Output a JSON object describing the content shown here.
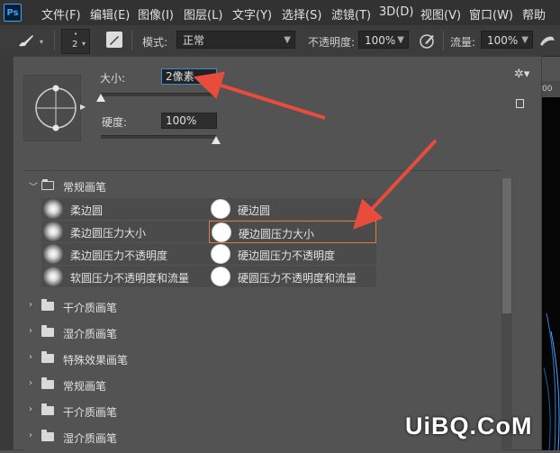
{
  "app": {
    "logo": "Ps"
  },
  "menu": [
    {
      "label": "文件(F)"
    },
    {
      "label": "编辑(E)"
    },
    {
      "label": "图像(I)"
    },
    {
      "label": "图层(L)"
    },
    {
      "label": "文字(Y)"
    },
    {
      "label": "选择(S)"
    },
    {
      "label": "滤镜(T)"
    },
    {
      "label": "3D(D)"
    },
    {
      "label": "视图(V)"
    },
    {
      "label": "窗口(W)"
    },
    {
      "label": "帮助"
    }
  ],
  "options": {
    "brush_size": "2",
    "mode_label": "模式:",
    "mode_value": "正常",
    "opacity_label": "不透明度:",
    "opacity_value": "100%",
    "flow_label": "流量:",
    "flow_value": "100%"
  },
  "brush_panel": {
    "size_label": "大小:",
    "size_value": "2",
    "size_unit": "像素",
    "hardness_label": "硬度:",
    "hardness_value": "100%",
    "size_slider_fraction": 0.0,
    "hardness_slider_fraction": 1.0
  },
  "ruler_value": "00",
  "groups": [
    {
      "label": "常规画笔",
      "expanded": true,
      "brushes": [
        {
          "name": "柔边圆",
          "type": "soft"
        },
        {
          "name": "硬边圆",
          "type": "hard"
        },
        {
          "name": "柔边圆压力大小",
          "type": "soft"
        },
        {
          "name": "硬边圆压力大小",
          "type": "hard",
          "selected": true
        },
        {
          "name": "柔边圆压力不透明度",
          "type": "soft"
        },
        {
          "name": "硬边圆压力不透明度",
          "type": "hard"
        },
        {
          "name": "软圆压力不透明度和流量",
          "type": "soft"
        },
        {
          "name": "硬圆压力不透明度和流量",
          "type": "hard"
        }
      ]
    },
    {
      "label": "干介质画笔",
      "expanded": false
    },
    {
      "label": "湿介质画笔",
      "expanded": false
    },
    {
      "label": "特殊效果画笔",
      "expanded": false
    },
    {
      "label": "常规画笔",
      "expanded": false
    },
    {
      "label": "干介质画笔",
      "expanded": false
    },
    {
      "label": "湿介质画笔",
      "expanded": false
    }
  ],
  "watermark": "UiBQ.CoM",
  "colors": {
    "accent": "#e74c3c",
    "selection": "#e07b3a",
    "field_focus": "#3f88d6"
  }
}
